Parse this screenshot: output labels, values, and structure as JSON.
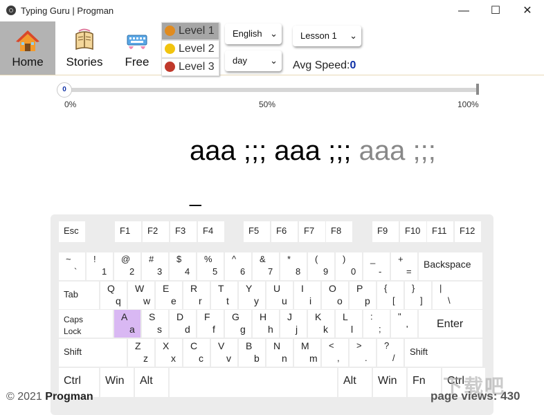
{
  "window": {
    "title": "Typing Guru | Progman",
    "minimize": "—",
    "maximize": "☐",
    "close": "✕"
  },
  "nav": [
    {
      "label": "Home",
      "icon": "house-icon",
      "active": true
    },
    {
      "label": "Stories",
      "icon": "book-icon",
      "active": false
    },
    {
      "label": "Free",
      "icon": "keyboard-icon",
      "active": false
    }
  ],
  "levels": [
    {
      "label": "Level 1",
      "badge": "1",
      "selected": true,
      "color": "#e08b1f"
    },
    {
      "label": "Level 2",
      "badge": "2",
      "selected": false,
      "color": "#f1c40f"
    },
    {
      "label": "Level 3",
      "badge": "3",
      "selected": false,
      "color": "#c0392b"
    }
  ],
  "selects": {
    "language": "English",
    "time": "day",
    "lesson": "Lesson 1"
  },
  "avg_speed": {
    "label": "Avg Speed:",
    "value": "0"
  },
  "progress": {
    "value": "0",
    "fraction": 0,
    "ticks": [
      "0%",
      "50%",
      "100%"
    ]
  },
  "typing": {
    "done": "aaa ;;; aaa ;;; ",
    "remaining": "aaa ;;;",
    "cursor": "_"
  },
  "keyboard": {
    "highlighted": "A",
    "rows": [
      [
        {
          "c": "Esc"
        },
        {
          "c": "F1"
        },
        {
          "c": "F2"
        },
        {
          "c": "F3"
        },
        {
          "c": "F4"
        },
        {
          "c": "F5"
        },
        {
          "c": "F6"
        },
        {
          "c": "F7"
        },
        {
          "c": "F8"
        },
        {
          "c": "F9"
        },
        {
          "c": "F10"
        },
        {
          "c": "F11"
        },
        {
          "c": "F12"
        }
      ],
      [
        {
          "u": "~",
          "d": "`"
        },
        {
          "u": "!",
          "d": "1"
        },
        {
          "u": "@",
          "d": "2"
        },
        {
          "u": "#",
          "d": "3"
        },
        {
          "u": "$",
          "d": "4"
        },
        {
          "u": "%",
          "d": "5"
        },
        {
          "u": "^",
          "d": "6"
        },
        {
          "u": "&",
          "d": "7"
        },
        {
          "u": "*",
          "d": "8"
        },
        {
          "u": "(",
          "d": "9"
        },
        {
          "u": ")",
          "d": "0"
        },
        {
          "u": "_",
          "d": "-"
        },
        {
          "u": "+",
          "d": "="
        },
        {
          "c": "Backspace"
        }
      ],
      [
        {
          "c": "Tab"
        },
        {
          "u": "Q",
          "d": "q"
        },
        {
          "u": "W",
          "d": "w"
        },
        {
          "u": "E",
          "d": "e"
        },
        {
          "u": "R",
          "d": "r"
        },
        {
          "u": "T",
          "d": "t"
        },
        {
          "u": "Y",
          "d": "y"
        },
        {
          "u": "U",
          "d": "u"
        },
        {
          "u": "I",
          "d": "i"
        },
        {
          "u": "O",
          "d": "o"
        },
        {
          "u": "P",
          "d": "p"
        },
        {
          "u": "{",
          "d": "["
        },
        {
          "u": "}",
          "d": "]"
        },
        {
          "u": "|",
          "d": "\\"
        }
      ],
      [
        {
          "c": "Caps Lock"
        },
        {
          "u": "A",
          "d": "a"
        },
        {
          "u": "S",
          "d": "s"
        },
        {
          "u": "D",
          "d": "d"
        },
        {
          "u": "F",
          "d": "f"
        },
        {
          "u": "G",
          "d": "g"
        },
        {
          "u": "H",
          "d": "h"
        },
        {
          "u": "J",
          "d": "j"
        },
        {
          "u": "K",
          "d": "k"
        },
        {
          "u": "L",
          "d": "l"
        },
        {
          "u": ":",
          "d": ";"
        },
        {
          "u": "\"",
          "d": "'"
        },
        {
          "c": "Enter"
        }
      ],
      [
        {
          "c": "Shift"
        },
        {
          "u": "Z",
          "d": "z"
        },
        {
          "u": "X",
          "d": "x"
        },
        {
          "u": "C",
          "d": "c"
        },
        {
          "u": "V",
          "d": "v"
        },
        {
          "u": "B",
          "d": "b"
        },
        {
          "u": "N",
          "d": "n"
        },
        {
          "u": "M",
          "d": "m"
        },
        {
          "u": "<",
          "d": ","
        },
        {
          "u": ">",
          "d": "."
        },
        {
          "u": "?",
          "d": "/"
        },
        {
          "c": "Shift"
        }
      ],
      [
        {
          "c": "Ctrl"
        },
        {
          "c": "Win"
        },
        {
          "c": "Alt"
        },
        {
          "c": ""
        },
        {
          "c": "Alt"
        },
        {
          "c": "Win"
        },
        {
          "c": "Fn"
        },
        {
          "c": "Ctrl"
        }
      ]
    ]
  },
  "footer": {
    "copyright": "© 2021",
    "brand": "Progman",
    "page_views_label": "page views:",
    "page_views": "430"
  },
  "watermark": "下载吧"
}
